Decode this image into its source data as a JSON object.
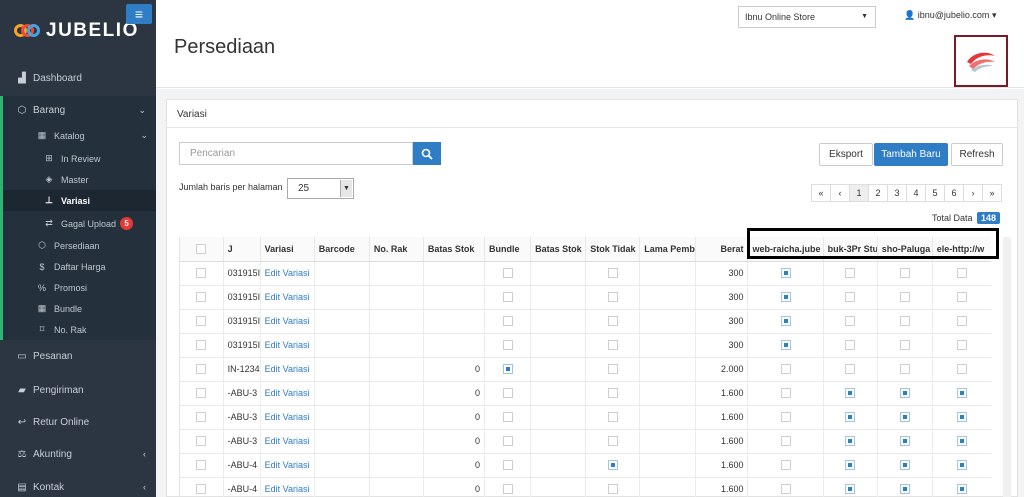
{
  "app": {
    "logo_text": "JUBELIO",
    "menu_toggle": "≡"
  },
  "sidebar": {
    "top_items": [
      {
        "label": "Dashboard",
        "icon": "chart-area-icon"
      },
      {
        "label": "Barang",
        "icon": "cubes-icon"
      }
    ],
    "barang_sub": [
      {
        "label": "Katalog",
        "icon": "grid-icon"
      },
      {
        "label": "In Review",
        "icon": "plus-square-icon"
      },
      {
        "label": "Master",
        "icon": "cube-icon"
      },
      {
        "label": "Variasi",
        "icon": "sitemap-icon",
        "active": true
      },
      {
        "label": "Gagal Upload",
        "icon": "exchange-icon",
        "badge": "5"
      },
      {
        "label": "Persediaan",
        "icon": "cubes-icon"
      },
      {
        "label": "Daftar Harga",
        "icon": "dollar-icon"
      },
      {
        "label": "Promosi",
        "icon": "percent-icon"
      },
      {
        "label": "Bundle",
        "icon": "grid-icon"
      },
      {
        "label": "No. Rak",
        "icon": "bookmark-icon"
      }
    ],
    "bottom_items": [
      {
        "label": "Pesanan",
        "icon": "hdd-icon"
      },
      {
        "label": "Pengiriman",
        "icon": "truck-icon"
      },
      {
        "label": "Retur Online",
        "icon": "reply-icon"
      },
      {
        "label": "Akunting",
        "icon": "balance-scale-icon"
      },
      {
        "label": "Kontak",
        "icon": "address-book-icon"
      }
    ]
  },
  "header": {
    "store": "Ibnu Online Store",
    "user": "ibnu@jubelio.com",
    "page_title": "Persediaan"
  },
  "panel": {
    "title": "Variasi",
    "search_placeholder": "Pencarian",
    "export_label": "Eksport",
    "add_label": "Tambah Baru",
    "refresh_label": "Refresh",
    "rows_label": "Jumlah baris per halaman",
    "rows_value": "25",
    "pager": [
      "«",
      "‹",
      "1",
      "2",
      "3",
      "4",
      "5",
      "6",
      "›",
      "»"
    ],
    "total_label": "Total Data",
    "total_count": "148"
  },
  "table": {
    "headers": [
      "",
      "J",
      "Variasi",
      "Barcode",
      "No. Rak",
      "Batas Stok",
      "Bundle",
      "Batas Stok",
      "Stok Tidak",
      "Lama Pemb",
      "Berat",
      "web-raicha.jube",
      "buk-3Pr Stu",
      "sho-Paluga",
      "ele-http://w"
    ],
    "rows": [
      {
        "sku": "031915I",
        "link": "Edit Variasi",
        "batas": "",
        "bundle": false,
        "stok": false,
        "berat": "300",
        "ch": [
          true,
          false,
          false,
          false
        ]
      },
      {
        "sku": "031915I",
        "link": "Edit Variasi",
        "batas": "",
        "bundle": false,
        "stok": false,
        "berat": "300",
        "ch": [
          true,
          false,
          false,
          false
        ]
      },
      {
        "sku": "031915I",
        "link": "Edit Variasi",
        "batas": "",
        "bundle": false,
        "stok": false,
        "berat": "300",
        "ch": [
          true,
          false,
          false,
          false
        ]
      },
      {
        "sku": "031915I",
        "link": "Edit Variasi",
        "batas": "",
        "bundle": false,
        "stok": false,
        "berat": "300",
        "ch": [
          true,
          false,
          false,
          false
        ]
      },
      {
        "sku": "IN-1234",
        "link": "Edit Variasi",
        "batas": "0",
        "bundle": true,
        "stok": false,
        "berat": "2.000",
        "ch": [
          false,
          false,
          false,
          false
        ]
      },
      {
        "sku": "-ABU-3",
        "link": "Edit Variasi",
        "batas": "0",
        "bundle": false,
        "stok": false,
        "berat": "1.600",
        "ch": [
          false,
          true,
          true,
          true
        ]
      },
      {
        "sku": "-ABU-3",
        "link": "Edit Variasi",
        "batas": "0",
        "bundle": false,
        "stok": false,
        "berat": "1.600",
        "ch": [
          false,
          true,
          true,
          true
        ]
      },
      {
        "sku": "-ABU-3",
        "link": "Edit Variasi",
        "batas": "0",
        "bundle": false,
        "stok": false,
        "berat": "1.600",
        "ch": [
          false,
          true,
          true,
          true
        ]
      },
      {
        "sku": "-ABU-4",
        "link": "Edit Variasi",
        "batas": "0",
        "bundle": false,
        "stok": true,
        "berat": "1.600",
        "ch": [
          false,
          true,
          true,
          true
        ]
      },
      {
        "sku": "-ABU-4",
        "link": "Edit Variasi",
        "batas": "0",
        "bundle": false,
        "stok": false,
        "berat": "1.600",
        "ch": [
          false,
          true,
          true,
          true
        ]
      }
    ]
  },
  "colors": {
    "sidebar_bg": "#2b3642",
    "accent": "#2e7dc5",
    "active_bar": "#2bb673",
    "badge": "#e53935"
  }
}
